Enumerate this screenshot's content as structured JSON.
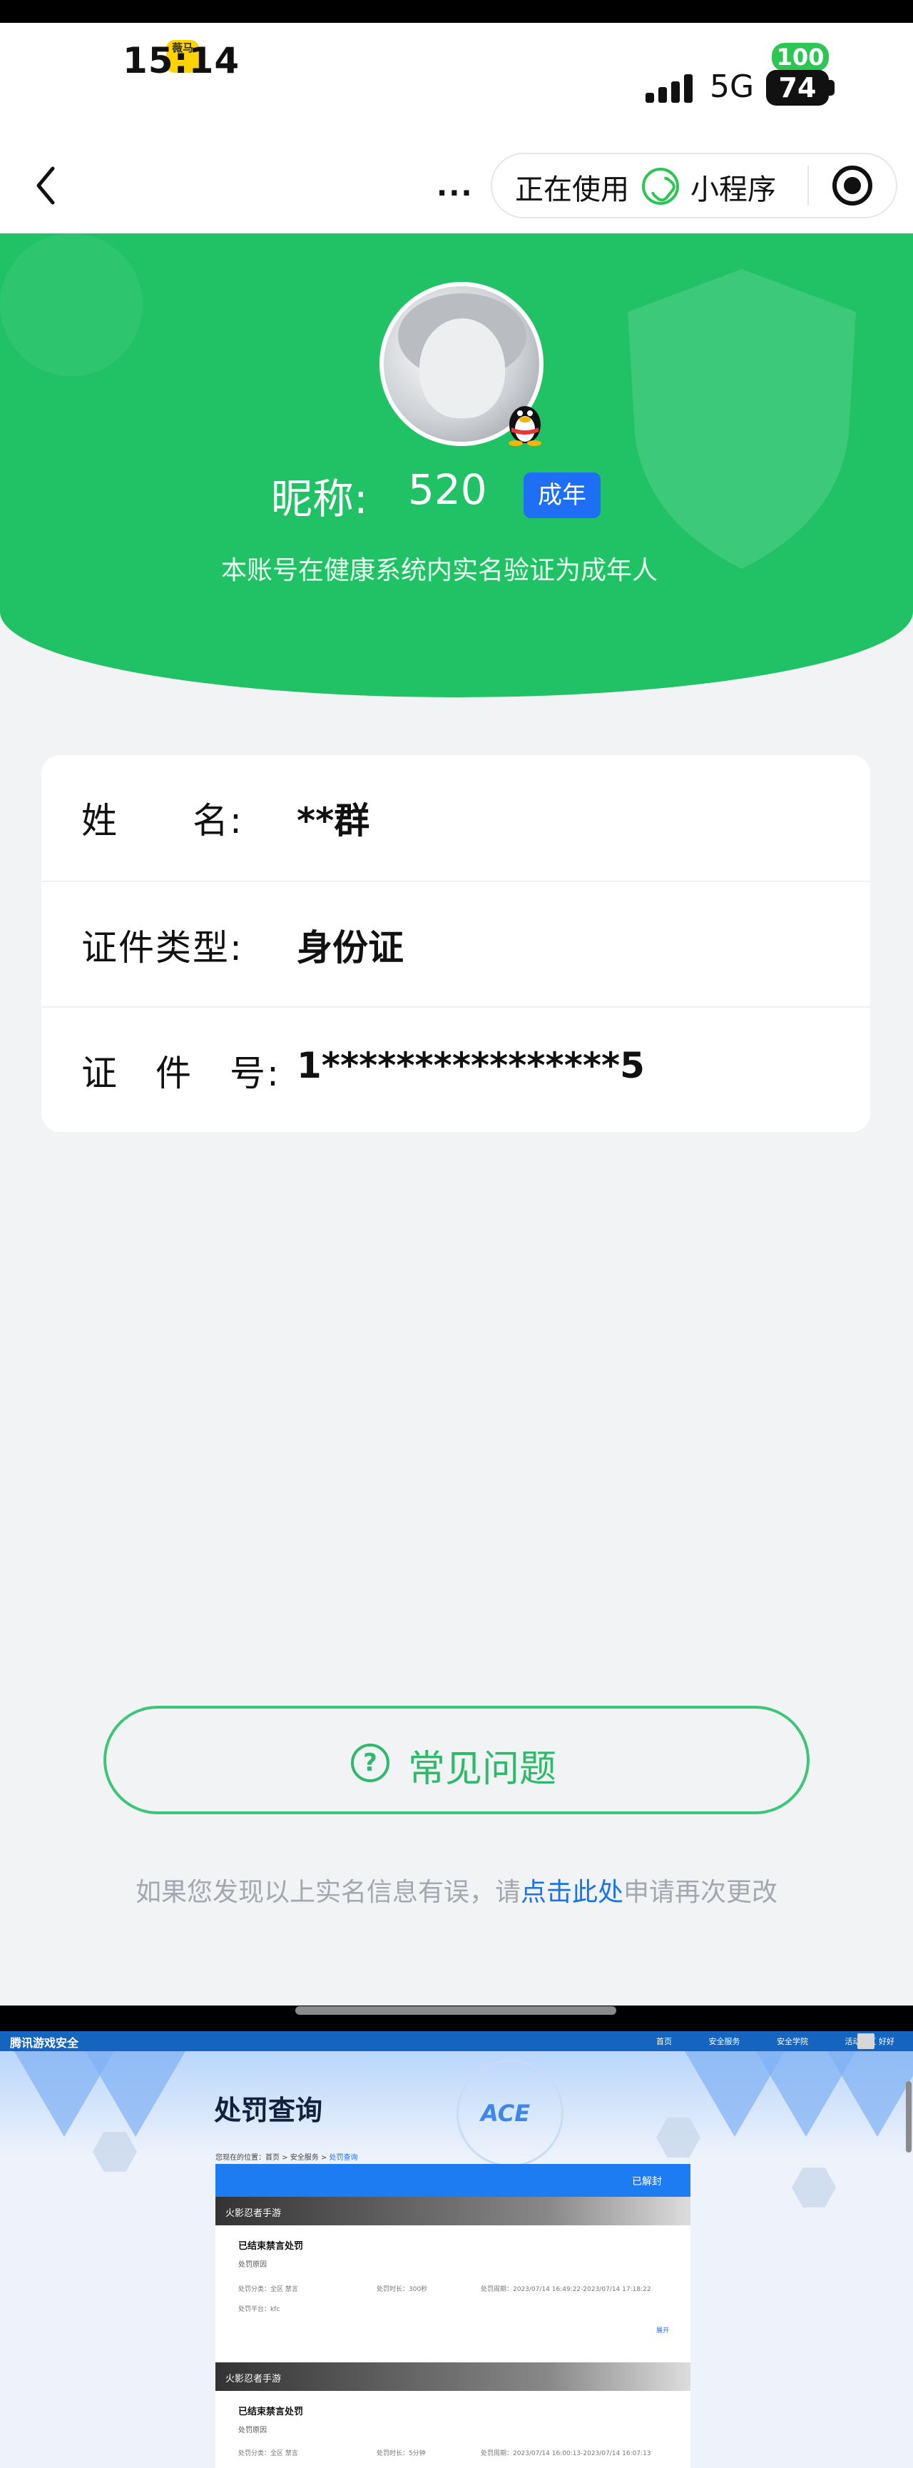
{
  "status_bar": {
    "time": "15:14",
    "app_badge": "薇马",
    "network": "5G",
    "battery_top": "100",
    "battery": "74"
  },
  "nav_bar": {
    "capsule_label": "正在使用",
    "capsule_mini": "小程序",
    "more": "..."
  },
  "profile": {
    "nickname_label": "昵称:",
    "nickname_value": "520",
    "badge": "成年",
    "description": "本账号在健康系统内实名验证为成年人"
  },
  "info": {
    "name_label": "姓　　名:",
    "name_value": "**群",
    "idtype_label": "证件类型:",
    "idtype_value": "身份证",
    "idno_label": "证　件　号:",
    "idno_value": "1****************5"
  },
  "faq": {
    "label": "常见问题",
    "icon": "?"
  },
  "correction": {
    "before": "如果您发现以上实名信息有误，请",
    "link": "点击此处",
    "after": "申请再次更改"
  },
  "screenshot": {
    "logo": "腾讯游戏安全",
    "nav_links": [
      "首页",
      "安全服务",
      "安全学院",
      "活动专区"
    ],
    "user": "好好",
    "title": "处罚查询",
    "ace": "ACE",
    "breadcrumb": {
      "prefix": "您现在的位置：首页 > 安全服务 > ",
      "current": "处罚查询"
    },
    "panel_status": "已解封",
    "records": [
      {
        "game": "火影忍者手游",
        "case": "已结束禁言处罚",
        "sub": "处罚原因",
        "meta1": "处罚分类：全区 禁言",
        "meta2": "处罚时长：300秒",
        "meta3": "处罚周期：2023/07/14 16:49:22-2023/07/14 17:18:22",
        "meta4": "处罚平台：kfc",
        "expand": "展开"
      },
      {
        "game": "火影忍者手游",
        "case": "已结束禁言处罚",
        "sub": "处罚原因",
        "meta1": "处罚分类：全区 禁言",
        "meta2": "处罚时长：5分钟",
        "meta3": "处罚周期：2023/07/14 16:00:13-2023/07/14 16:07:13"
      }
    ]
  },
  "colors": {
    "hero_green": "#21c266",
    "accent_blue": "#1e6ff5",
    "faq_green": "#2dbb6b"
  }
}
